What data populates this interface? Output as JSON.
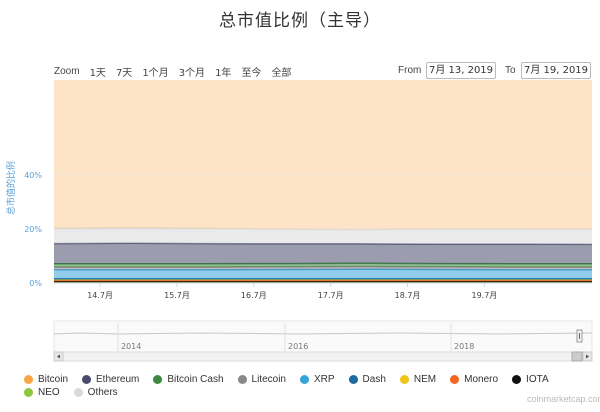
{
  "title": "总市值比例（主导）",
  "zoom": {
    "label": "Zoom",
    "buttons": [
      "1天",
      "7天",
      "1个月",
      "3个月",
      "1年",
      "至今",
      "全部"
    ]
  },
  "range": {
    "from_label": "From",
    "from_value": "7月 13, 2019",
    "to_label": "To",
    "to_value": "7月 19, 2019"
  },
  "navigator": {
    "year_labels": [
      "2014",
      "2016",
      "2018"
    ]
  },
  "watermark": "coinmarketcap.com",
  "colors": {
    "Bitcoin": "#f7a642",
    "Ethereum": "#4a4b6e",
    "Bitcoin Cash": "#3c8a3f",
    "Litecoin": "#888888",
    "XRP": "#36a3d9",
    "Dash": "#1c6aa0",
    "NEM": "#f0c419",
    "Monero": "#f26822",
    "IOTA": "#111111",
    "NEO": "#8dc63f",
    "Others": "#d9d9d9"
  },
  "chart_data": {
    "type": "area",
    "stacked": true,
    "ylabel": "总市值的比例",
    "y_ticks": [
      "0%",
      "20%",
      "40%"
    ],
    "ylim": [
      0,
      70
    ],
    "x_ticks": [
      "14.7月",
      "15.7月",
      "16.7月",
      "17.7月",
      "18.7月",
      "19.7月"
    ],
    "x": [
      "13.7",
      "14.7",
      "15.7",
      "16.7",
      "17.7",
      "18.7",
      "19.7",
      "19.7+"
    ],
    "legend_position": "bottom",
    "series": [
      {
        "name": "Bitcoin",
        "values": [
          64.6,
          64.5,
          64.6,
          65.1,
          65.2,
          64.8,
          64.6,
          64.9
        ]
      },
      {
        "name": "Ethereum",
        "values": [
          7.5,
          7.6,
          7.5,
          7.3,
          7.2,
          7.2,
          7.3,
          7.2
        ]
      },
      {
        "name": "Bitcoin Cash",
        "values": [
          1.2,
          1.2,
          1.2,
          1.2,
          1.2,
          1.2,
          1.2,
          1.2
        ]
      },
      {
        "name": "Litecoin",
        "values": [
          1.0,
          1.0,
          1.0,
          1.0,
          1.0,
          1.0,
          1.0,
          1.0
        ]
      },
      {
        "name": "XRP",
        "values": [
          3.3,
          3.3,
          3.3,
          3.4,
          3.5,
          3.4,
          3.3,
          3.3
        ]
      },
      {
        "name": "Dash",
        "values": [
          0.3,
          0.3,
          0.3,
          0.3,
          0.3,
          0.3,
          0.3,
          0.3
        ]
      },
      {
        "name": "NEM",
        "values": [
          0.2,
          0.2,
          0.2,
          0.2,
          0.2,
          0.2,
          0.2,
          0.2
        ]
      },
      {
        "name": "Monero",
        "values": [
          0.5,
          0.5,
          0.5,
          0.5,
          0.5,
          0.5,
          0.5,
          0.5
        ]
      },
      {
        "name": "IOTA",
        "values": [
          0.3,
          0.3,
          0.3,
          0.3,
          0.3,
          0.3,
          0.3,
          0.3
        ]
      },
      {
        "name": "NEO",
        "values": [
          0.3,
          0.3,
          0.3,
          0.3,
          0.3,
          0.3,
          0.3,
          0.3
        ]
      },
      {
        "name": "Others",
        "values": [
          5.6,
          5.6,
          5.6,
          5.4,
          5.3,
          5.6,
          5.6,
          5.6
        ]
      }
    ]
  },
  "legend_rows": [
    [
      "Bitcoin",
      "Ethereum",
      "Bitcoin Cash",
      "Litecoin",
      "XRP",
      "Dash",
      "NEM",
      "Monero",
      "IOTA"
    ],
    [
      "NEO",
      "Others"
    ]
  ]
}
